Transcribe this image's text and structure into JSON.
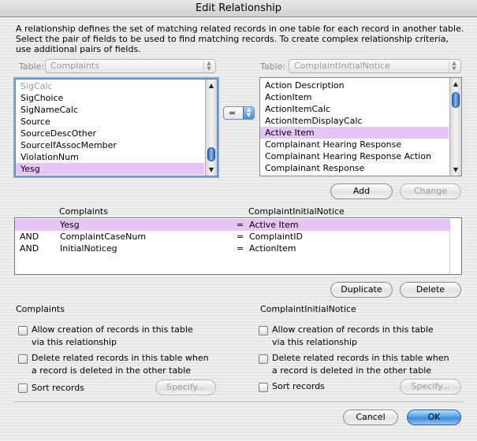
{
  "window": {
    "title": "Edit Relationship"
  },
  "description": "A relationship defines the set of matching related records in one table for each record in another table. Select the pair of fields to be used to find matching records. To create complex relationship criteria, use additional pairs of fields.",
  "left_table": {
    "label": "Table:",
    "value": "Complaints",
    "fields": [
      "SigCalc",
      "SigChoice",
      "SigNameCalc",
      "Source",
      "SourceDescOther",
      "SourceIfAssocMember",
      "ViolationNum",
      "Yesg"
    ],
    "selected": "Yesg"
  },
  "right_table": {
    "label": "Table:",
    "value": "ComplaintInitialNotice",
    "fields": [
      "Action Description",
      "ActionItem",
      "ActionItemCalc",
      "ActionItemDisplayCalc",
      "Active Item",
      "Complainant Hearing Response",
      "Complainant Hearing Response Action",
      "Complainant Response"
    ],
    "selected": "Active Item"
  },
  "operator": {
    "value": "="
  },
  "buttons": {
    "add": "Add",
    "change": "Change",
    "duplicate": "Duplicate",
    "delete": "Delete",
    "cancel": "Cancel",
    "ok": "OK"
  },
  "criteria": {
    "headers": {
      "left": "Complaints",
      "right": "ComplaintInitialNotice"
    },
    "rows": [
      {
        "conj": "",
        "left": "Yesg",
        "op": "=",
        "right": "Active Item",
        "selected": true
      },
      {
        "conj": "AND",
        "left": "ComplaintCaseNum",
        "op": "=",
        "right": "ComplaintID",
        "selected": false
      },
      {
        "conj": "AND",
        "left": "InitialNoticeg",
        "op": "=",
        "right": "ActionItem",
        "selected": false
      }
    ]
  },
  "left_options": {
    "title": "Complaints",
    "allow_creation": {
      "line1": "Allow creation of records in this table",
      "line2": "via this relationship",
      "checked": false
    },
    "delete_related": {
      "line1": "Delete related records in this table when",
      "line2": "a record is deleted in the other table",
      "checked": false
    },
    "sort_records": {
      "label": "Sort records",
      "checked": false
    },
    "specify": "Specify..."
  },
  "right_options": {
    "title": "ComplaintInitialNotice",
    "allow_creation": {
      "line1": "Allow creation of records in this table",
      "line2": "via this relationship",
      "checked": false
    },
    "delete_related": {
      "line1": "Delete related records in this table when",
      "line2": "a record is deleted in the other table",
      "checked": false
    },
    "sort_records": {
      "label": "Sort records",
      "checked": false
    },
    "specify": "Specify..."
  }
}
